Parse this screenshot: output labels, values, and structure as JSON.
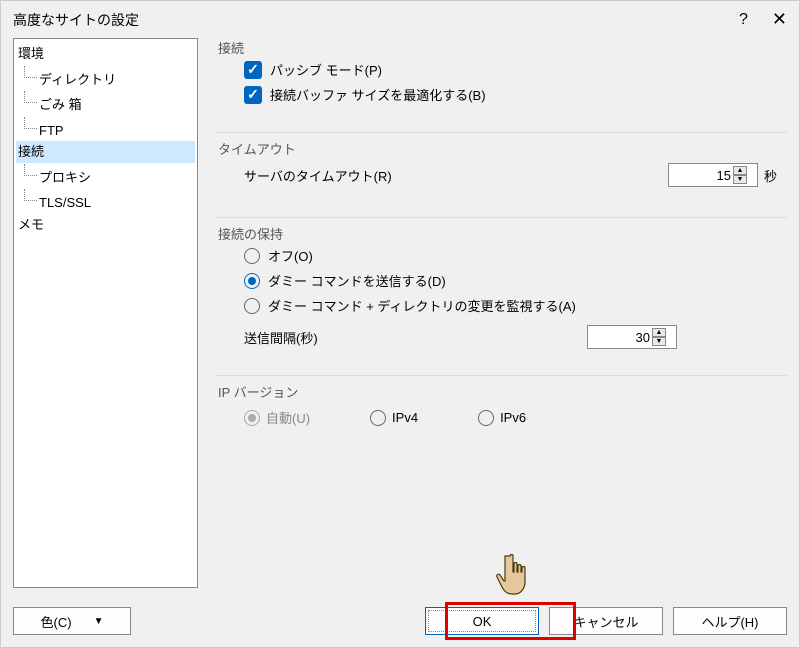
{
  "title": "高度なサイトの設定",
  "titlebar": {
    "help": "?",
    "close": "✕"
  },
  "tree": {
    "environment": "環境",
    "directory": "ディレクトリ",
    "trash": "ごみ 箱",
    "ftp": "FTP",
    "connection": "接続",
    "proxy": "プロキシ",
    "tlsssl": "TLS/SSL",
    "memo": "メモ"
  },
  "groups": {
    "connection": "接続",
    "timeout": "タイムアウト",
    "keepalive": "接続の保持",
    "ipversion": "IP バージョン"
  },
  "connection": {
    "passive": "パッシブ モード(P)",
    "passive_checked": true,
    "optimizeBuffer": "接続バッファ サイズを最適化する(B)",
    "optimizeBuffer_checked": true
  },
  "timeout": {
    "label": "サーバのタイムアウト(R)",
    "value": "15",
    "unit": "秒"
  },
  "keepalive": {
    "off": "オフ(O)",
    "dummy": "ダミー コマンドを送信する(D)",
    "dummydir": "ダミー コマンド + ディレクトリの変更を監視する(A)",
    "selected": "dummy",
    "intervalLabel": "送信間隔(秒)",
    "intervalValue": "30"
  },
  "ipversion": {
    "auto": "自動(U)",
    "ipv4": "IPv4",
    "ipv6": "IPv6",
    "selected": "auto",
    "auto_disabled": true
  },
  "footer": {
    "color": "色(C)",
    "ok": "OK",
    "cancel": "キャンセル",
    "help": "ヘルプ(H)"
  }
}
